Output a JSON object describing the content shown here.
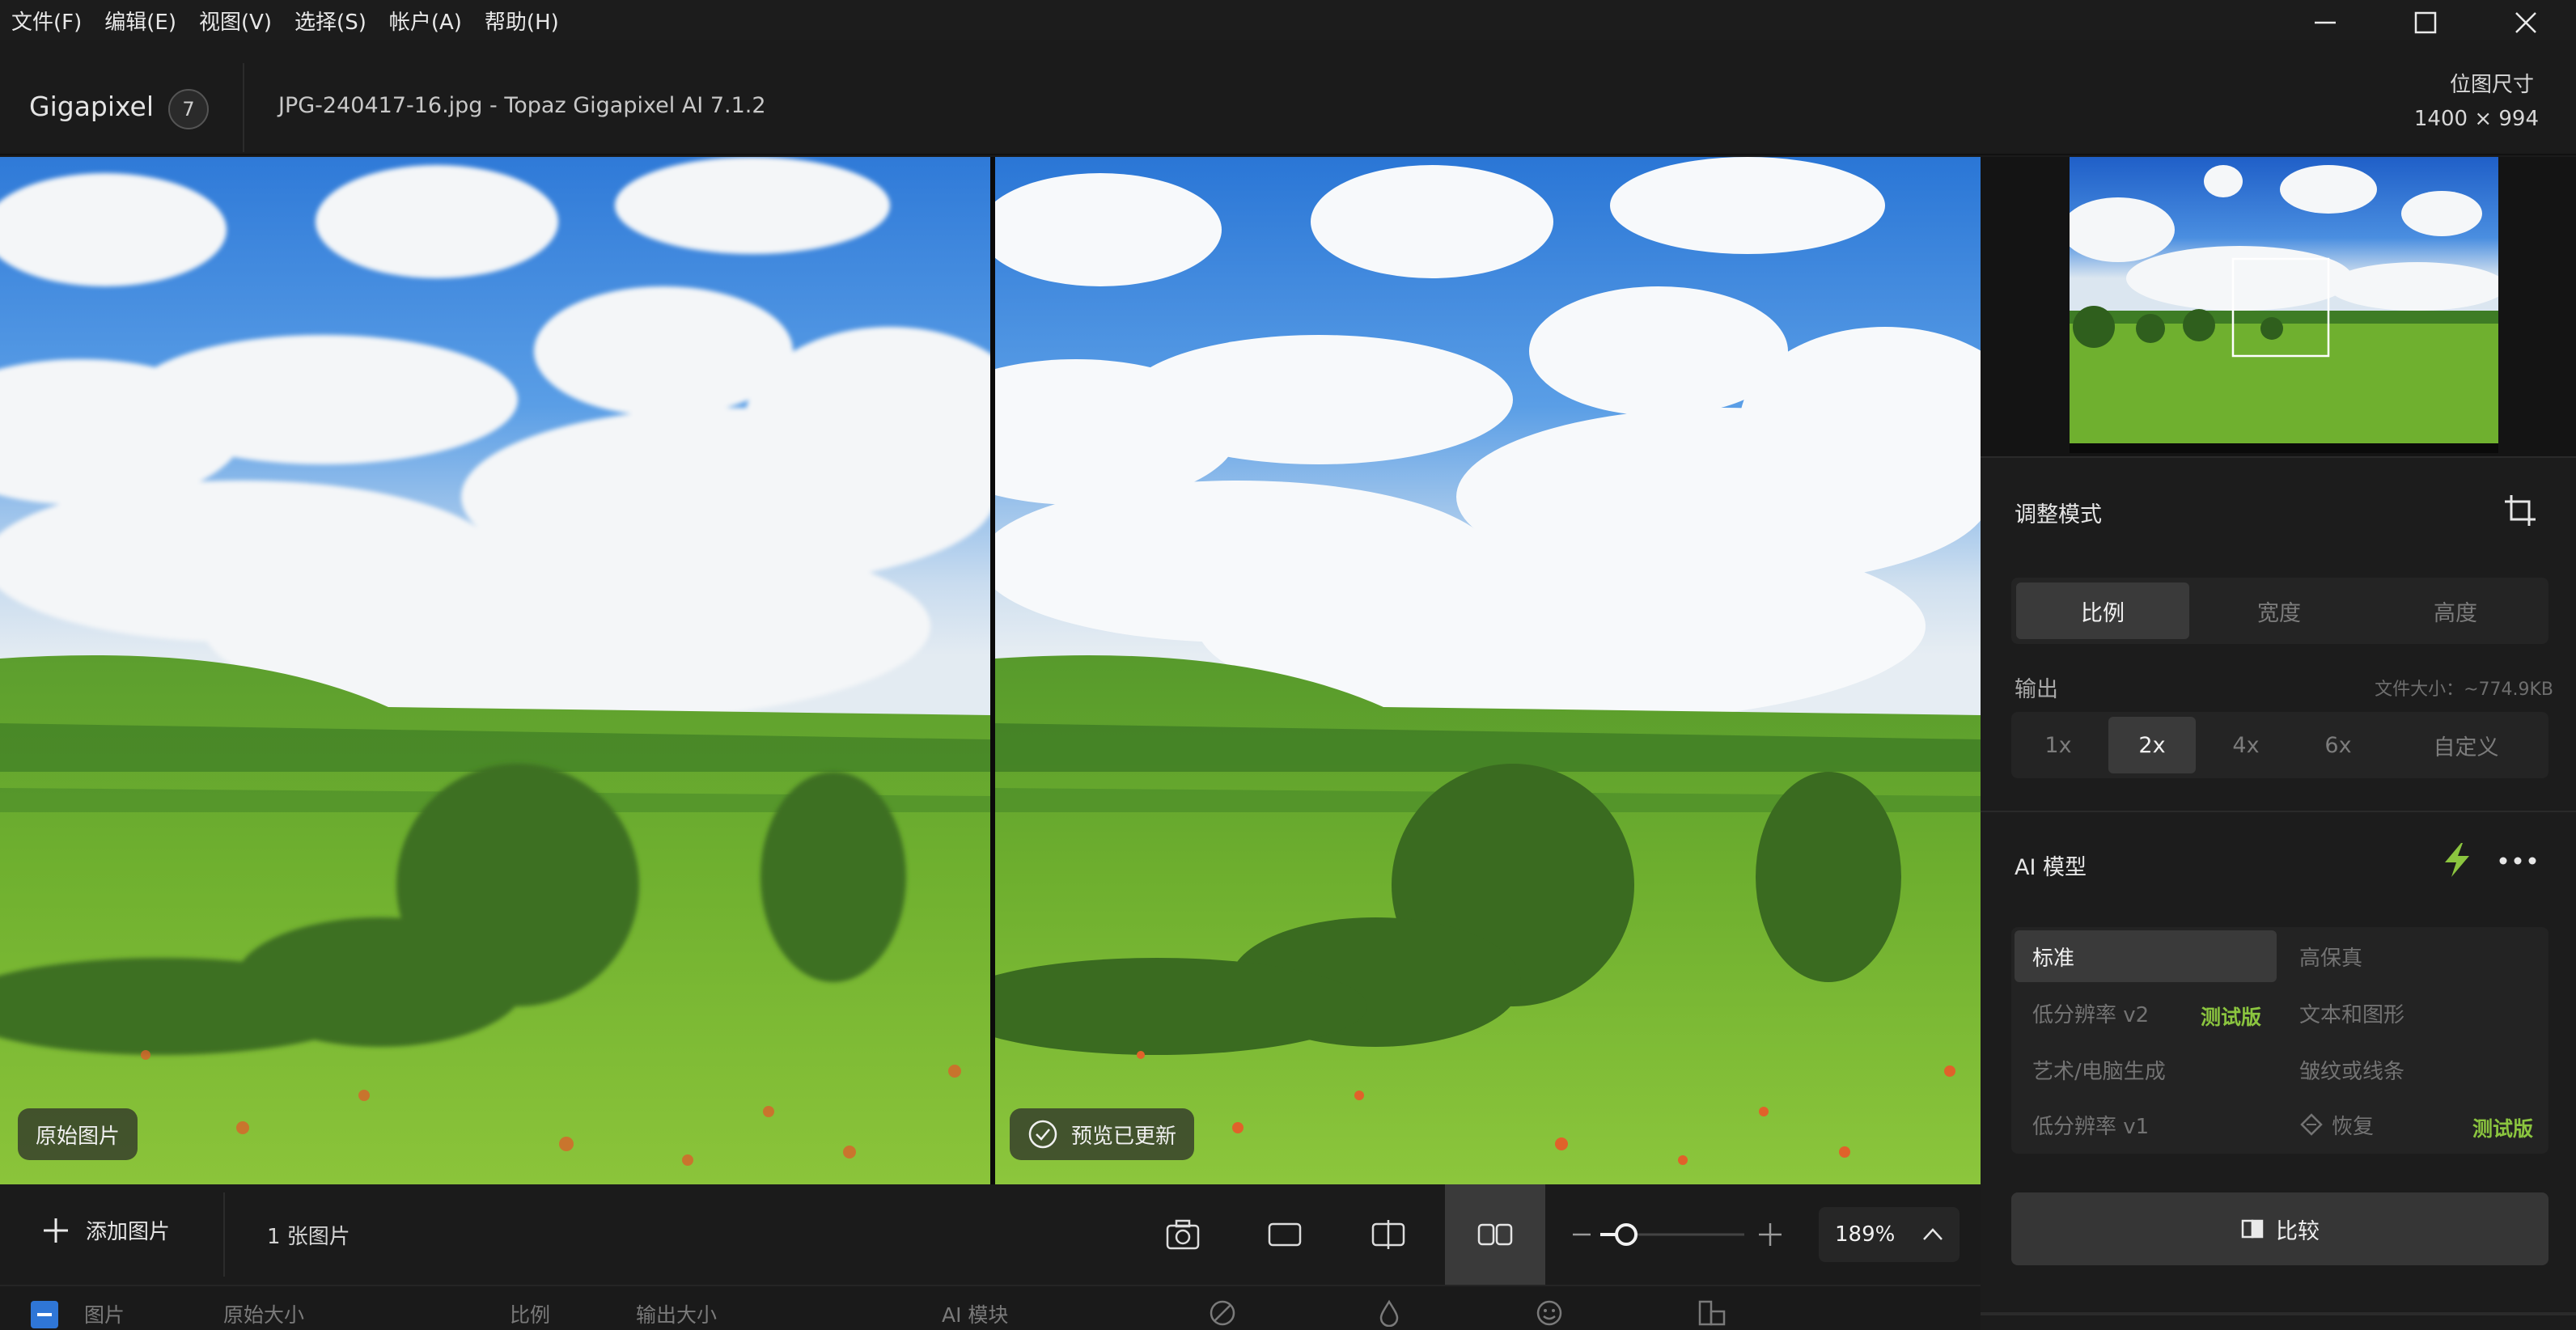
{
  "menu": [
    "文件(F)",
    "编辑(E)",
    "视图(V)",
    "选择(S)",
    "帐户(A)",
    "帮助(H)"
  ],
  "app": {
    "name": "Gigapixel",
    "badge": "7",
    "doc_title": "JPG-240417-16.jpg - Topaz Gigapixel AI 7.1.2"
  },
  "bitmap": {
    "label": "位图尺寸",
    "value": "1400 × 994"
  },
  "viewer": {
    "left_label": "原始图片",
    "right_label": "预览已更新"
  },
  "toolbar": {
    "add_image": "添加图片",
    "image_count": "1 张图片",
    "zoom": "189%",
    "zoom_level": 0.18
  },
  "list_header": {
    "image": "图片",
    "orig_size": "原始大小",
    "scale": "比例",
    "out_size": "输出大小",
    "ai_model": "AI 模块"
  },
  "panel": {
    "adjust_mode": {
      "title": "调整模式",
      "options": [
        "比例",
        "宽度",
        "高度"
      ],
      "selected": 0
    },
    "output": {
      "title": "输出",
      "file_size": "文件大小：~774.9KB",
      "options": [
        "1x",
        "2x",
        "4x",
        "6x",
        "自定义"
      ],
      "selected": 1
    },
    "ai_model": {
      "title": "AI 模型",
      "models": {
        "standard": "标准",
        "hifi": "高保真",
        "lowres_v2": "低分辨率 v2",
        "lowres_v2_badge": "测试版",
        "text_graphics": "文本和图形",
        "art_cg": "艺术/电脑生成",
        "lines": "皱纹或线条",
        "lowres_v1": "低分辨率 v1",
        "recover": "恢复",
        "recover_badge": "测试版"
      }
    },
    "compare_button": "比较"
  },
  "colors": {
    "accent_green": "#8bc53f",
    "checkbox_blue": "#2f76d6",
    "selected_bg": "#3a3a3a"
  }
}
